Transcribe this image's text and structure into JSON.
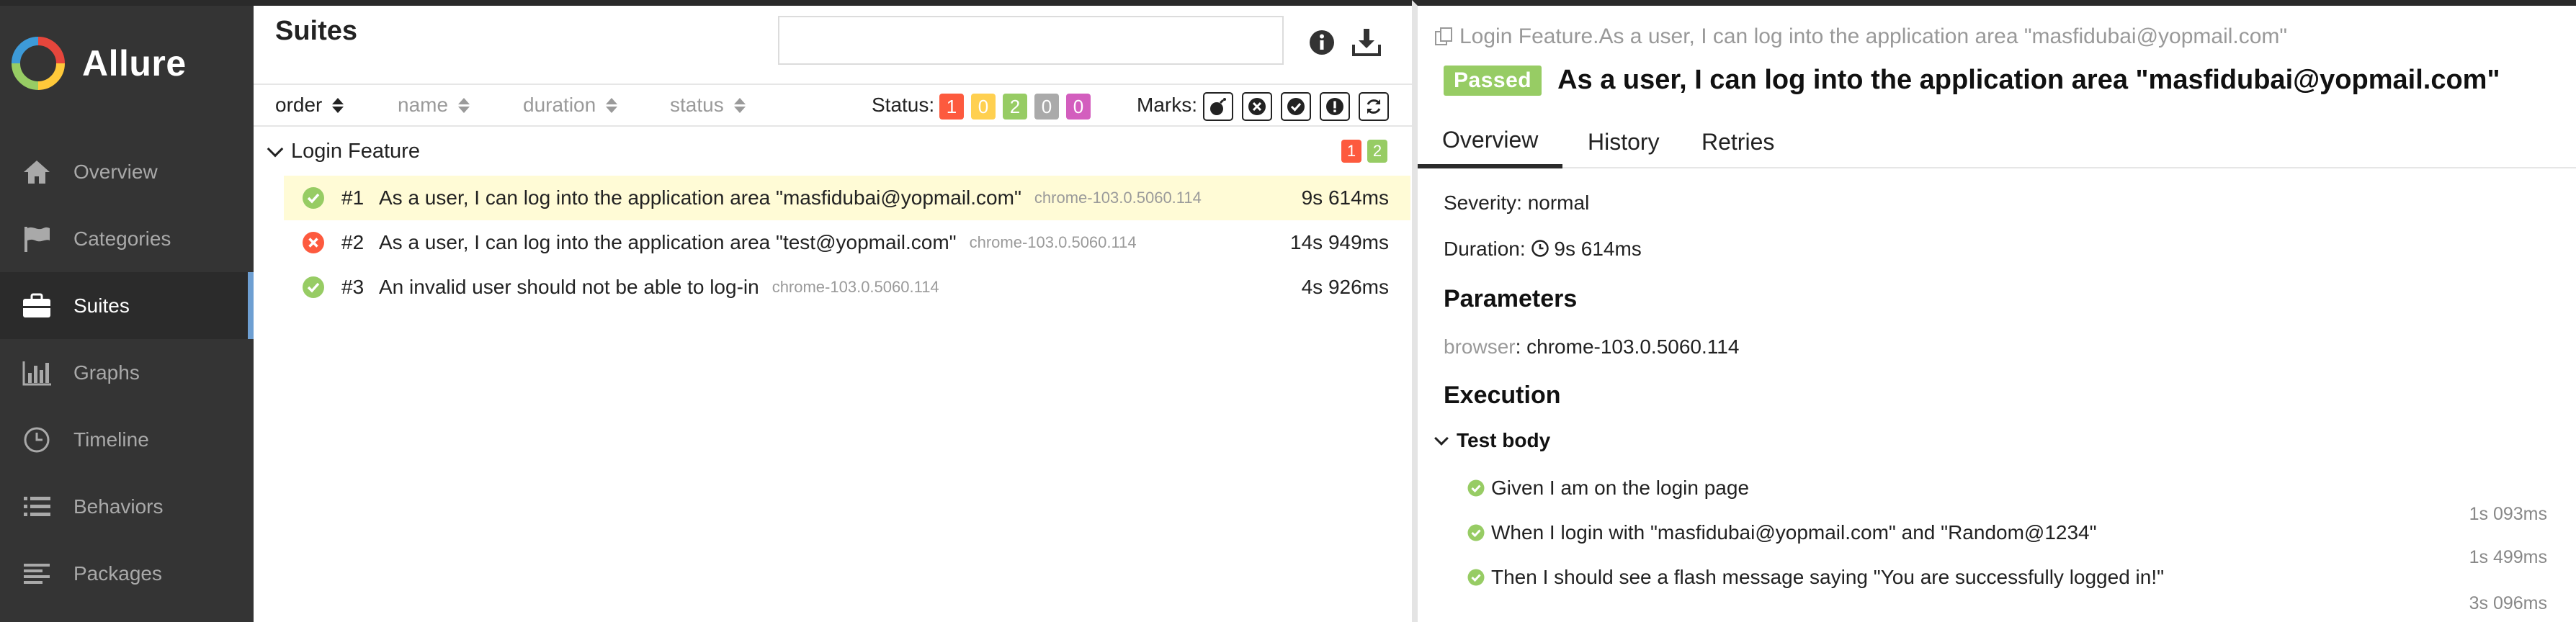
{
  "sidebar": {
    "brand": "Allure",
    "items": [
      {
        "label": "Overview",
        "icon": "home-icon"
      },
      {
        "label": "Categories",
        "icon": "flag-icon"
      },
      {
        "label": "Suites",
        "icon": "briefcase-icon",
        "active": true
      },
      {
        "label": "Graphs",
        "icon": "bar-chart-icon"
      },
      {
        "label": "Timeline",
        "icon": "clock-icon"
      },
      {
        "label": "Behaviors",
        "icon": "list-icon"
      },
      {
        "label": "Packages",
        "icon": "align-left-icon"
      }
    ]
  },
  "tree": {
    "title": "Suites",
    "search_value": "",
    "sort_columns": [
      "order",
      "name",
      "duration",
      "status"
    ],
    "status_label": "Status:",
    "status_counts": [
      {
        "value": "1",
        "color": "#fd5a3e"
      },
      {
        "value": "0",
        "color": "#ffd050"
      },
      {
        "value": "2",
        "color": "#97cc64"
      },
      {
        "value": "0",
        "color": "#aaaaaa"
      },
      {
        "value": "0",
        "color": "#d35ebe"
      }
    ],
    "marks_label": "Marks:",
    "group": {
      "name": "Login Feature",
      "failed": "1",
      "passed": "2"
    },
    "tests": [
      {
        "num": "#1",
        "name": "As a user, I can log into the application area \"masfidubai@yopmail.com\"",
        "param": "chrome-103.0.5060.114",
        "duration": "9s 614ms",
        "status": "passed"
      },
      {
        "num": "#2",
        "name": "As a user, I can log into the application area \"test@yopmail.com\"",
        "param": "chrome-103.0.5060.114",
        "duration": "14s 949ms",
        "status": "failed"
      },
      {
        "num": "#3",
        "name": "An invalid user should not be able to log-in",
        "param": "chrome-103.0.5060.114",
        "duration": "4s 926ms",
        "status": "passed"
      }
    ]
  },
  "detail": {
    "breadcrumb": "Login Feature.As a user, I can log into the application area \"masfidubai@yopmail.com\"",
    "status_badge": "Passed",
    "title": "As a user, I can log into the application area \"masfidubai@yopmail.com\"",
    "tabs": [
      "Overview",
      "History",
      "Retries"
    ],
    "severity": "Severity: normal",
    "duration_label": "Duration:",
    "duration_value": "9s 614ms",
    "parameters_heading": "Parameters",
    "param_name": "browser",
    "param_value": ": chrome-103.0.5060.114",
    "execution_heading": "Execution",
    "test_body_label": "Test body",
    "steps": [
      {
        "text": "Given I am on the login page",
        "duration": "1s 093ms"
      },
      {
        "text": "When I login with \"masfidubai@yopmail.com\" and \"Random@1234\"",
        "duration": "1s 499ms"
      },
      {
        "text": "Then I should see a flash message saying \"You are successfully logged in!\"",
        "duration": "3s 096ms"
      }
    ]
  }
}
